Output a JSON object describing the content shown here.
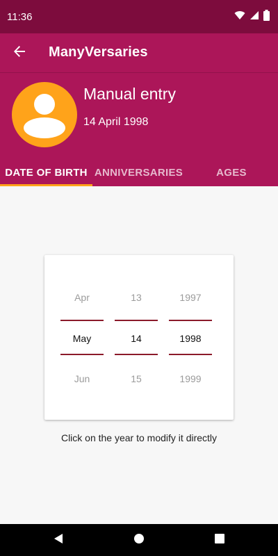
{
  "status_bar": {
    "time": "11:36"
  },
  "app_bar": {
    "title": "ManyVersaries"
  },
  "entry": {
    "name": "Manual entry",
    "date": "14 April 1998"
  },
  "tabs": [
    {
      "label": "DATE OF BIRTH",
      "active": true
    },
    {
      "label": "ANNIVERSARIES",
      "active": false
    },
    {
      "label": "AGES",
      "active": false
    }
  ],
  "picker": {
    "month": {
      "prev": "Apr",
      "current": "May",
      "next": "Jun"
    },
    "day": {
      "prev": "13",
      "current": "14",
      "next": "15"
    },
    "year": {
      "prev": "1997",
      "current": "1998",
      "next": "1999"
    }
  },
  "hint": "Click on the year to modify it directly",
  "colors": {
    "status_bar": "#7d0c3d",
    "primary": "#ac1659",
    "accent": "#ffa31a",
    "selection_line": "#8b1a2a"
  },
  "icons": {
    "back": "arrow-left-icon",
    "avatar": "person-icon",
    "wifi": "wifi-icon",
    "signal": "signal-icon",
    "battery": "battery-icon",
    "nav_back": "triangle-back-icon",
    "nav_home": "circle-home-icon",
    "nav_recents": "square-recents-icon"
  }
}
